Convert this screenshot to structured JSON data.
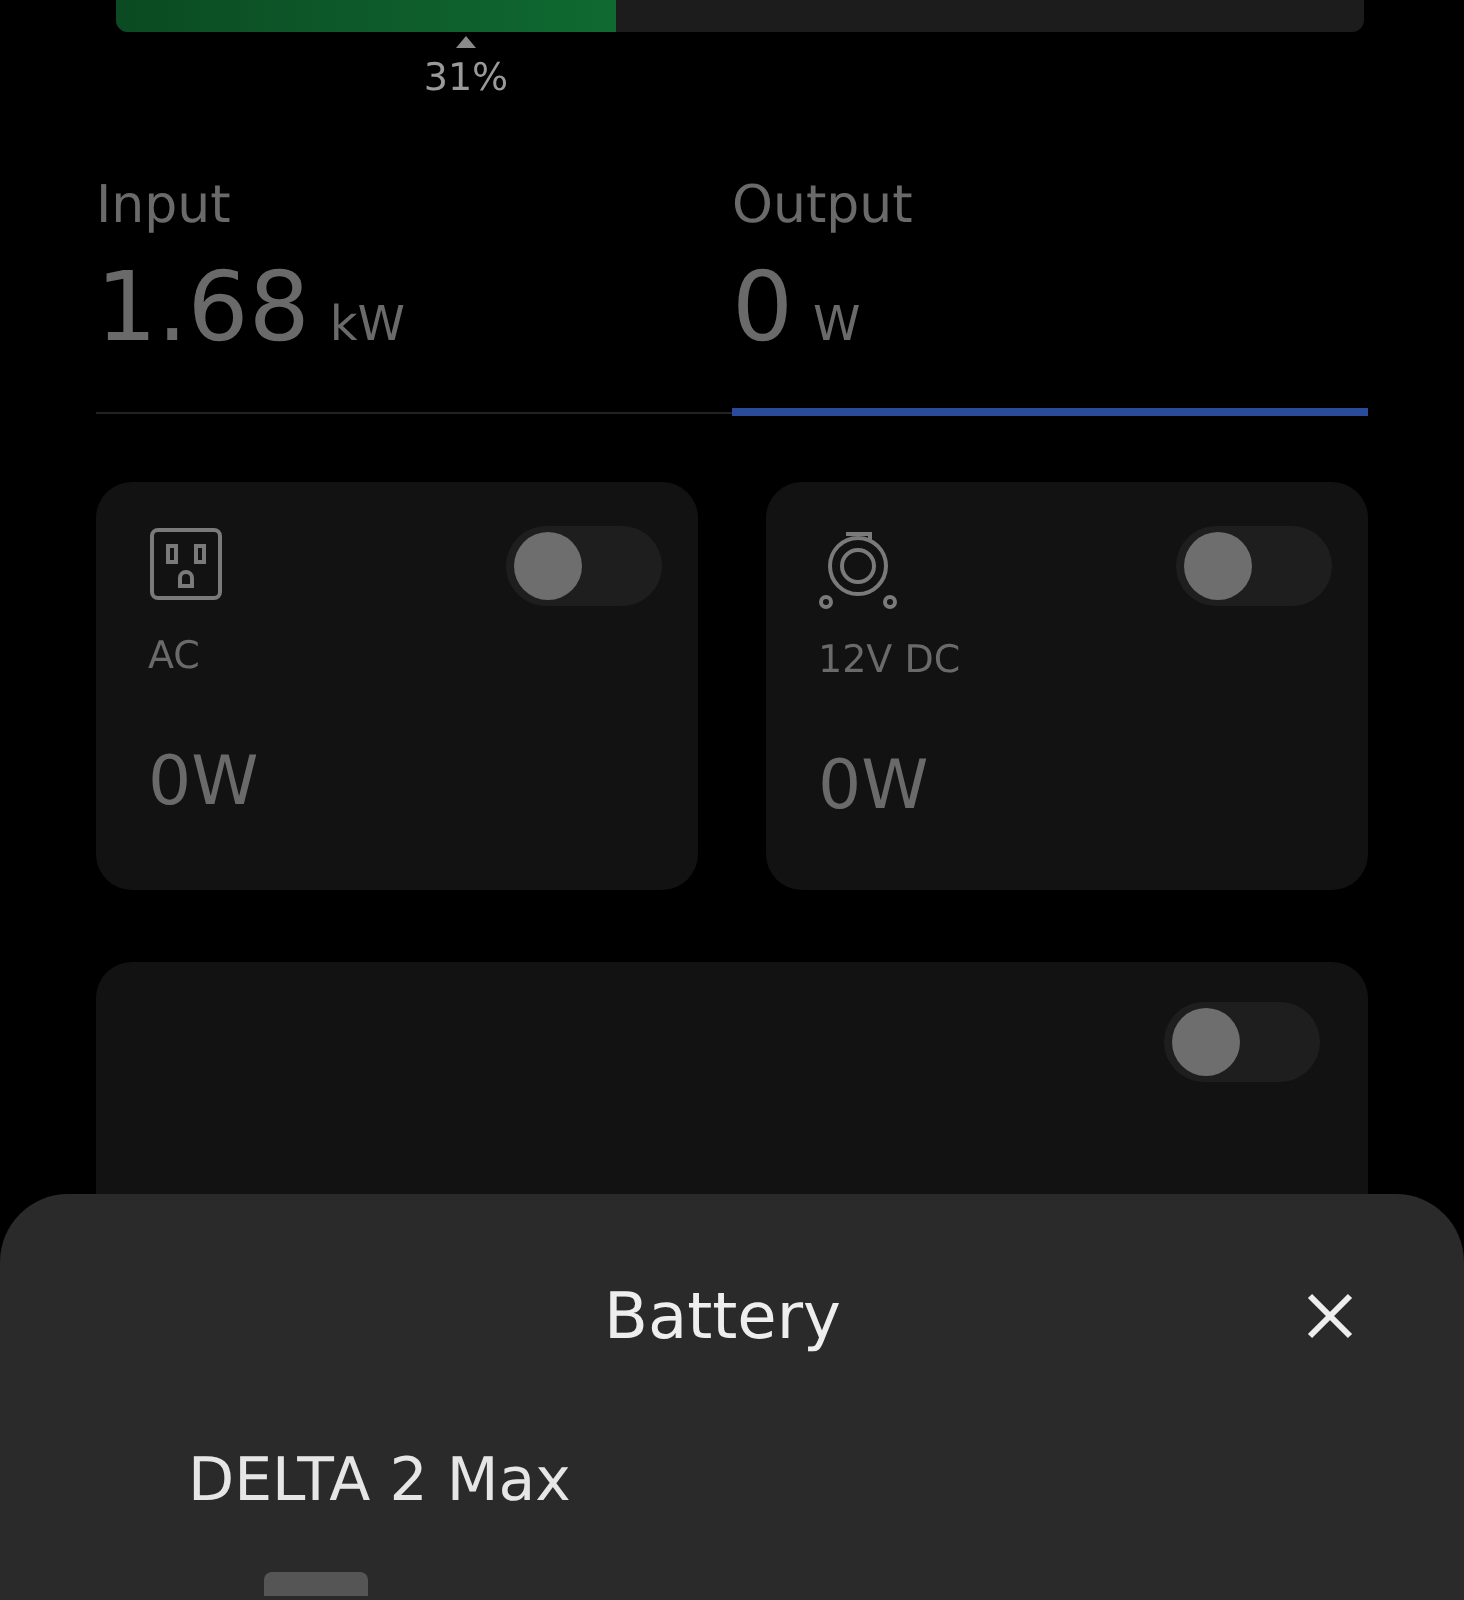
{
  "battery_bar": {
    "level": 0.4,
    "marker": "31%"
  },
  "tabs": [
    {
      "label": "Input",
      "value": "1.68",
      "unit": "kW",
      "selected": false
    },
    {
      "label": "Output",
      "value": "0",
      "unit": "W",
      "selected": true
    }
  ],
  "ports": [
    {
      "kind": "ac",
      "label": "AC",
      "power": "0W",
      "on": false
    },
    {
      "kind": "dc",
      "label": "12V DC",
      "power": "0W",
      "on": false
    }
  ],
  "partial_card": {
    "on": false
  },
  "sheet": {
    "title": "Battery",
    "device": "DELTA 2 Max"
  }
}
